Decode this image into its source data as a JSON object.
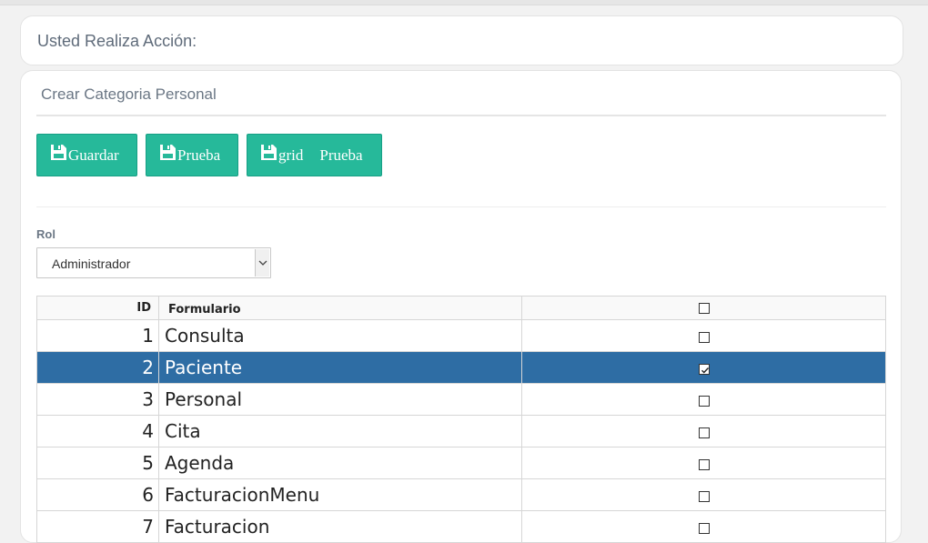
{
  "action_card": {
    "title": "Usted Realiza Acción:"
  },
  "main_card": {
    "title": "Crear Categoria Personal"
  },
  "buttons": {
    "guardar": "Guardar",
    "prueba": "Prueba",
    "grid_left": "grid",
    "grid_right": "Prueba"
  },
  "icons": {
    "button_icon": "floppy-disk-icon",
    "select_arrow": "chevron-down-icon",
    "checkbox": "checkbox-icon"
  },
  "rol": {
    "label": "Rol",
    "selected": "Administrador"
  },
  "table": {
    "headers": {
      "id": "ID",
      "form": "Formulario"
    },
    "rows": [
      {
        "id": "1",
        "form": "Consulta",
        "checked": false
      },
      {
        "id": "2",
        "form": "Paciente",
        "checked": true
      },
      {
        "id": "3",
        "form": "Personal",
        "checked": false
      },
      {
        "id": "4",
        "form": "Cita",
        "checked": false
      },
      {
        "id": "5",
        "form": "Agenda",
        "checked": false
      },
      {
        "id": "6",
        "form": "FacturacionMenu",
        "checked": false
      },
      {
        "id": "7",
        "form": "Facturacion",
        "checked": false
      }
    ],
    "selected_row_index": 1
  },
  "colors": {
    "button_bg": "#26b99a",
    "selected_row": "#2e6da4",
    "page_bg": "#f2f2f2"
  }
}
